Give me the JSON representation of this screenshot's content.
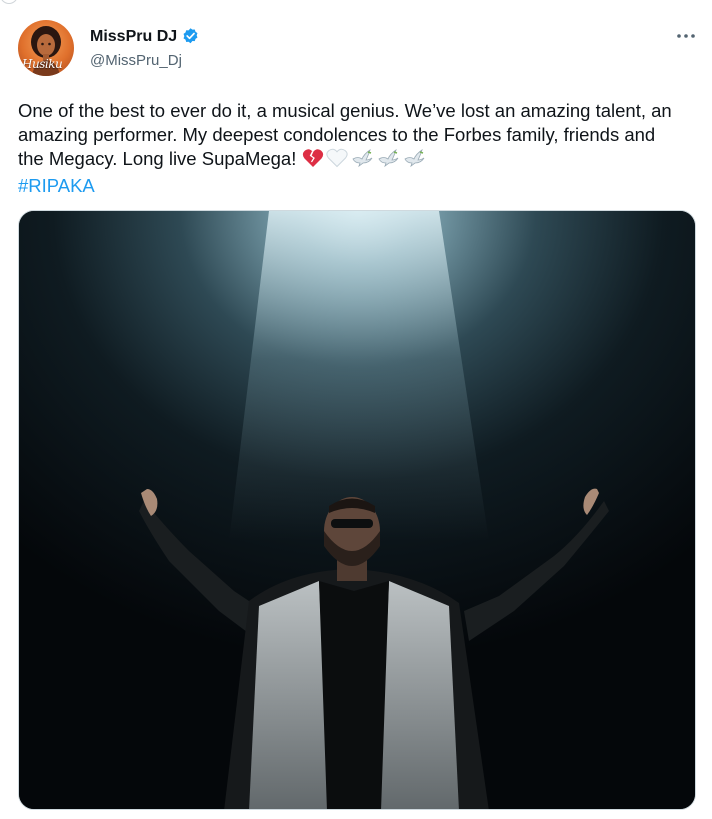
{
  "author": {
    "display_name": "MissPru DJ",
    "handle": "@MissPru_Dj",
    "avatar_caption": "Husiku",
    "verified": true
  },
  "tweet": {
    "text": "One of the best to ever do it, a musical genius. We’ve lost an amazing talent, an amazing performer. My deepest condolences to the Forbes family, friends and the Megacy. Long live SupaMega!",
    "emojis": [
      "broken-heart",
      "white-heart",
      "dove",
      "dove",
      "dove"
    ],
    "hashtag": "#RIPAKA"
  },
  "colors": {
    "text": "#0f1419",
    "secondary": "#536471",
    "link": "#1d9bf0",
    "verified": "#1d9bf0"
  },
  "icons": {
    "more": "more-horizontal-icon",
    "verified": "verified-badge-icon"
  }
}
